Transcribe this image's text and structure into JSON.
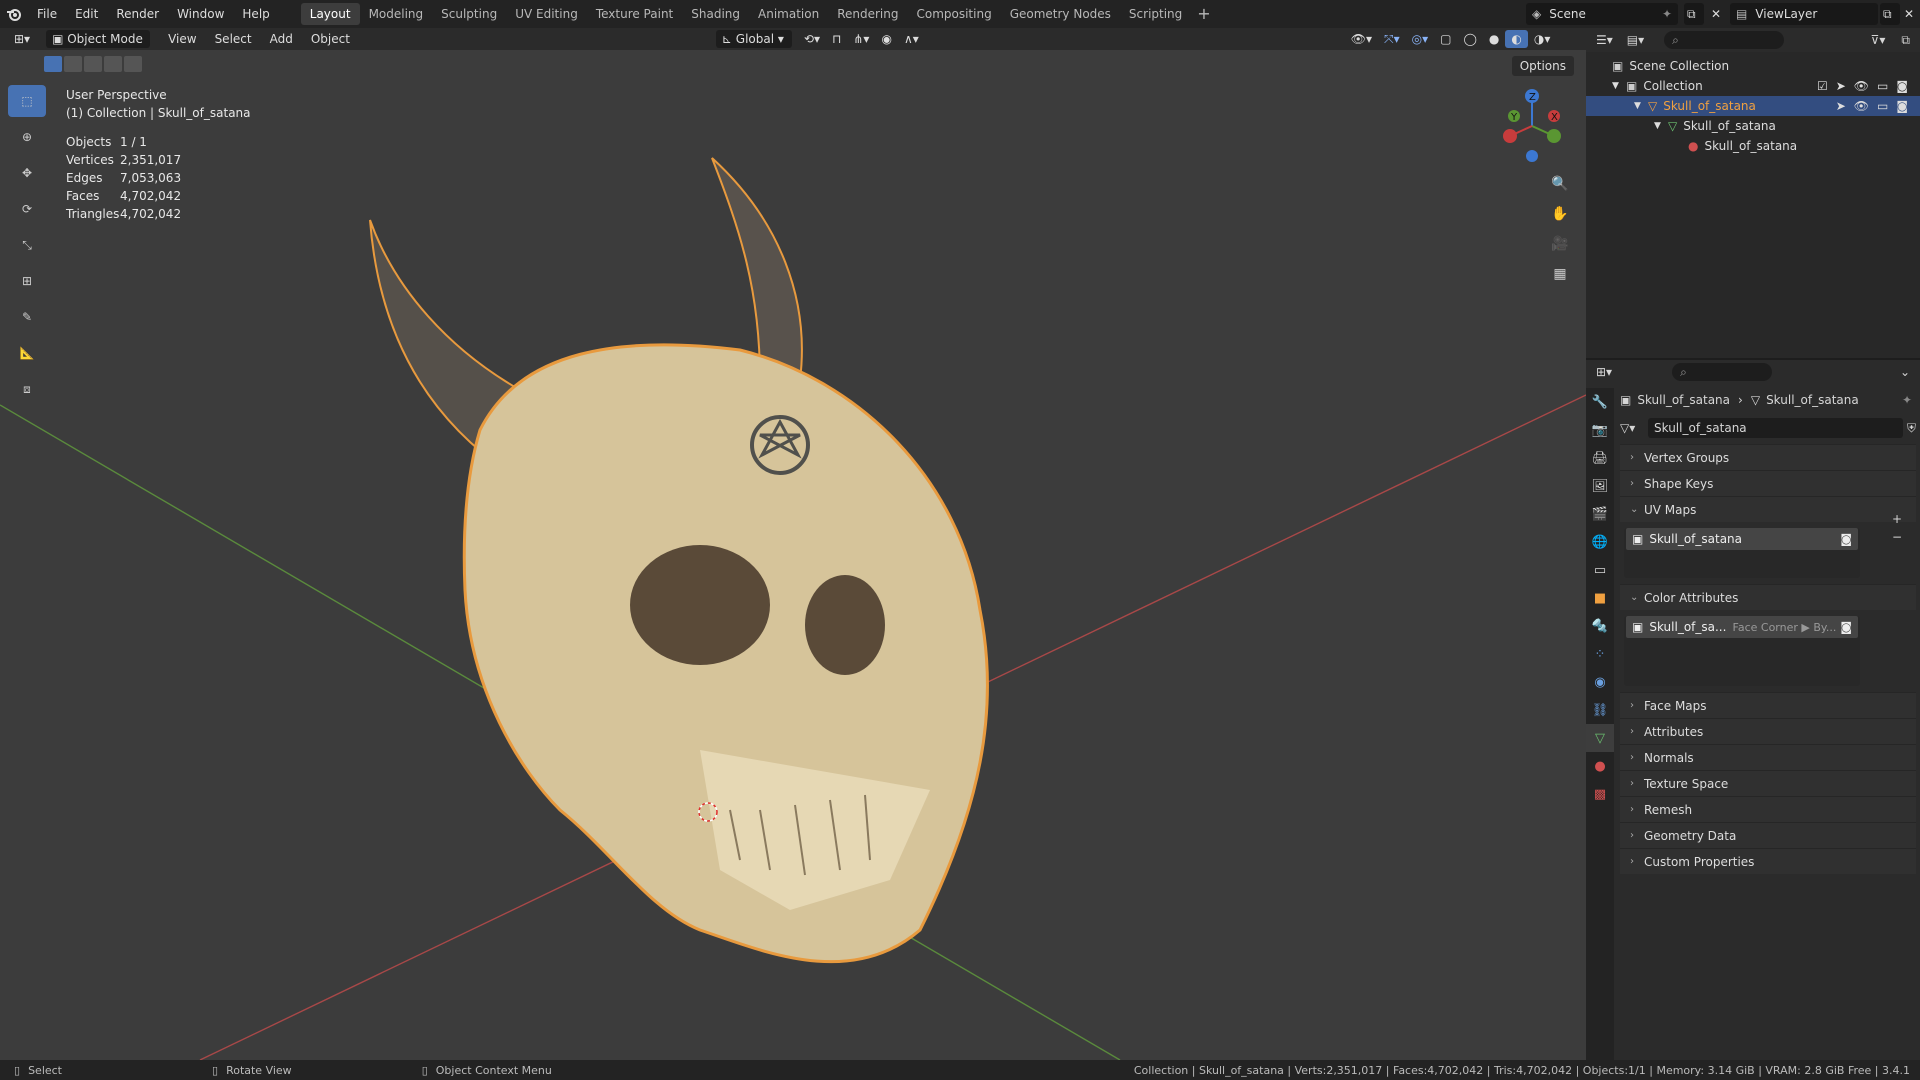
{
  "menubar": {
    "items": [
      "File",
      "Edit",
      "Render",
      "Window",
      "Help"
    ]
  },
  "workspaces": {
    "tabs": [
      "Layout",
      "Modeling",
      "Sculpting",
      "UV Editing",
      "Texture Paint",
      "Shading",
      "Animation",
      "Rendering",
      "Compositing",
      "Geometry Nodes",
      "Scripting"
    ],
    "active": "Layout"
  },
  "scene": {
    "label": "Scene"
  },
  "viewlayer": {
    "label": "ViewLayer"
  },
  "viewport_header": {
    "mode": "Object Mode",
    "menus": [
      "View",
      "Select",
      "Add",
      "Object"
    ],
    "transform_orientation": "Global",
    "options_label": "Options"
  },
  "viewport": {
    "view_name": "User Perspective",
    "collection_info": "(1) Collection | Skull_of_satana"
  },
  "stats": [
    {
      "label": "Objects",
      "value": "1 / 1"
    },
    {
      "label": "Vertices",
      "value": "2,351,017"
    },
    {
      "label": "Edges",
      "value": "7,053,063"
    },
    {
      "label": "Faces",
      "value": "4,702,042"
    },
    {
      "label": "Triangles",
      "value": "4,702,042"
    }
  ],
  "outliner": {
    "scene_collection": "Scene Collection",
    "collection": "Collection",
    "object": "Skull_of_satana",
    "mesh": "Skull_of_satana",
    "material": "Skull_of_satana"
  },
  "properties": {
    "breadcrumb_object": "Skull_of_satana",
    "breadcrumb_mesh": "Skull_of_satana",
    "data_name": "Skull_of_satana",
    "panels_top": [
      "Vertex Groups",
      "Shape Keys"
    ],
    "uv_maps": {
      "title": "UV Maps",
      "items": [
        "Skull_of_satana"
      ]
    },
    "color_attributes": {
      "title": "Color Attributes",
      "item": "Skull_of_sa...",
      "domain": "Face Corner ▶ By..."
    },
    "panels_bottom": [
      "Face Maps",
      "Attributes",
      "Normals",
      "Texture Space",
      "Remesh",
      "Geometry Data",
      "Custom Properties"
    ]
  },
  "statusbar": {
    "left": [
      {
        "icon": "mouse-left-icon",
        "label": "Select"
      },
      {
        "icon": "mouse-middle-icon",
        "label": "Rotate View"
      },
      {
        "icon": "mouse-right-icon",
        "label": "Object Context Menu"
      }
    ],
    "right": "Collection | Skull_of_satana | Verts:2,351,017 | Faces:4,702,042 | Tris:4,702,042 | Objects:1/1 | Memory: 3.14 GiB | VRAM: 2.8 GiB Free | 3.4.1"
  },
  "colors": {
    "accent": "#4772b3",
    "selection_outline": "#f0a040",
    "x_axis": "#c83c3c",
    "y_axis": "#5a9632",
    "z_axis": "#3c78d2"
  }
}
